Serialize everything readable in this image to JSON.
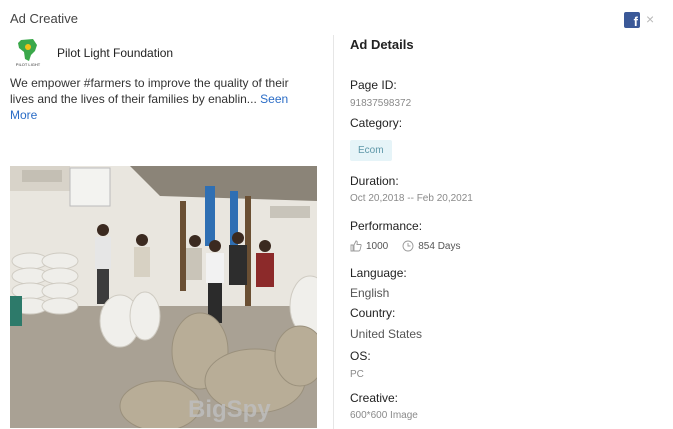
{
  "header": {
    "title": "Ad Creative",
    "close_glyph": "×",
    "facebook_glyph": "f"
  },
  "ad": {
    "page_name": "Pilot Light Foundation",
    "text": "We empower #farmers to improve the quality of their lives and the lives of their families by enablin...",
    "see_more": "Seen More",
    "logo_caption": "PILOT LIGHT",
    "image_watermark": "BigSpy"
  },
  "details": {
    "title": "Ad Details",
    "page_id_label": "Page ID:",
    "page_id": "91837598372",
    "category_label": "Category:",
    "category": "Ecom",
    "duration_label": "Duration:",
    "duration": "Oct 20,2018 -- Feb 20,2021",
    "performance_label": "Performance:",
    "likes": "1000",
    "days": "854 Days",
    "language_label": "Language:",
    "language": "English",
    "country_label": "Country:",
    "country": "United States",
    "os_label": "OS:",
    "os": "PC",
    "creative_label": "Creative:",
    "creative": "600*600 Image"
  },
  "icons": {
    "facebook": "facebook-icon",
    "close": "close-icon",
    "like": "thumbs-up-icon",
    "clock": "clock-icon"
  },
  "colors": {
    "facebook_blue": "#3b5998",
    "link_blue": "#2a6cc6",
    "tag_bg": "#e6f4f8",
    "tag_text": "#5e97a8"
  }
}
